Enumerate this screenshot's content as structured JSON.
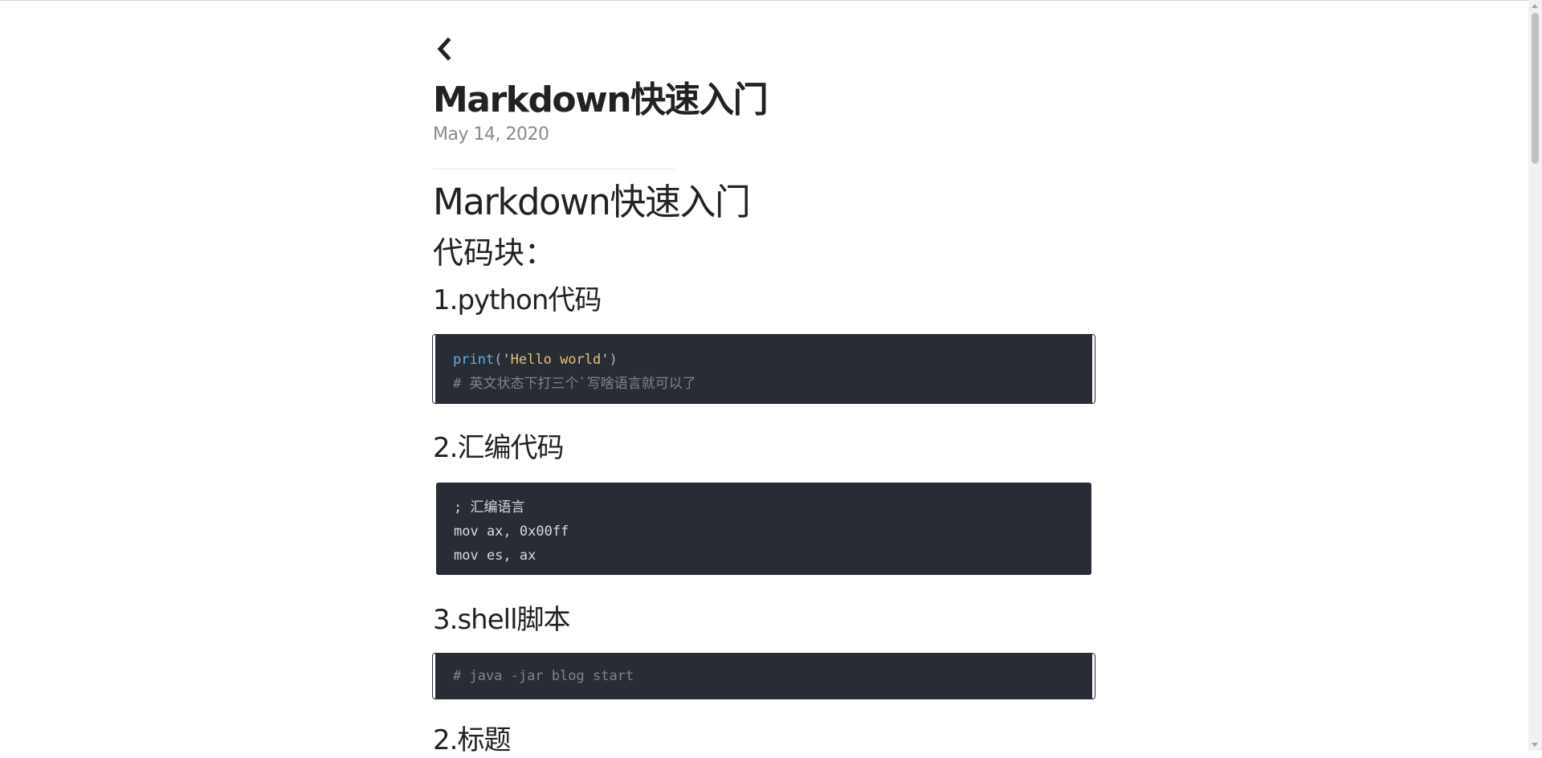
{
  "post": {
    "title": "Markdown快速入门",
    "date": "May 14, 2020"
  },
  "content": {
    "h1": "Markdown快速入门",
    "h2": "代码块：",
    "sections": [
      {
        "heading": "1.python代码",
        "code": {
          "fn": "print",
          "open_paren": "(",
          "string": "'Hello world'",
          "close_paren": ")",
          "comment": "# 英文状态下打三个`写啥语言就可以了"
        }
      },
      {
        "heading": "2.汇编代码",
        "lines": [
          "; 汇编语言",
          "mov ax, 0x00ff",
          "mov es, ax"
        ]
      },
      {
        "heading": "3.shell脚本",
        "lines": [
          "# java -jar blog start"
        ]
      },
      {
        "heading": "2.标题"
      }
    ]
  },
  "icons": {
    "back": "chevron-left-icon"
  },
  "colors": {
    "code_background": "#282c34",
    "code_function": "#61afef",
    "code_string": "#e5c07b",
    "code_comment": "#7f848e"
  }
}
